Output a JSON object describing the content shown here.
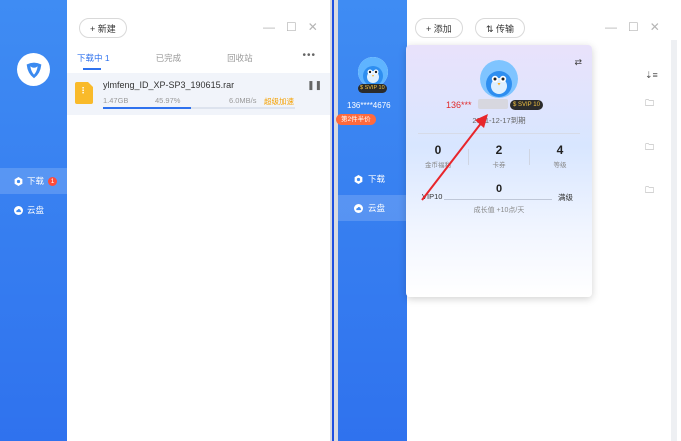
{
  "left_window": {
    "new_button": "+ 新建",
    "nav": [
      {
        "label": "下载",
        "badge": "1"
      },
      {
        "label": "云盘"
      }
    ],
    "tabs": [
      "下载中 1",
      "已完成",
      "回收站"
    ],
    "more": "•••",
    "download": {
      "name": "ylmfeng_ID_XP-SP3_190615.rar",
      "size": "1.47GB",
      "percent_text": "45.97%",
      "speed": "6.0MB/s",
      "accel": "超级加速",
      "progress": 0.4597
    }
  },
  "right_window": {
    "add_button": "+ 添加",
    "transfer_button": "⇅ 传输",
    "side_phone": "136****4676",
    "side_vip": "$ SVIP 10",
    "side_promo": "第2件半价",
    "nav": [
      {
        "label": "下载"
      },
      {
        "label": "云盘"
      }
    ]
  },
  "card": {
    "phone": "136***",
    "vip_badge": "$ SVIP 10",
    "expire": "2021-12-17到期",
    "stats": [
      {
        "num": "0",
        "label": "金币福利"
      },
      {
        "num": "2",
        "label": "卡券"
      },
      {
        "num": "4",
        "label": "等级"
      }
    ],
    "vip_level": "VIP10",
    "vip_value": "0",
    "vip_max": "满级",
    "growth": "成长值 +10点/天"
  },
  "colors": {
    "brand_blue": "#2f72ee",
    "accent_orange": "#f5a100",
    "alert_red": "#e02b2b"
  }
}
